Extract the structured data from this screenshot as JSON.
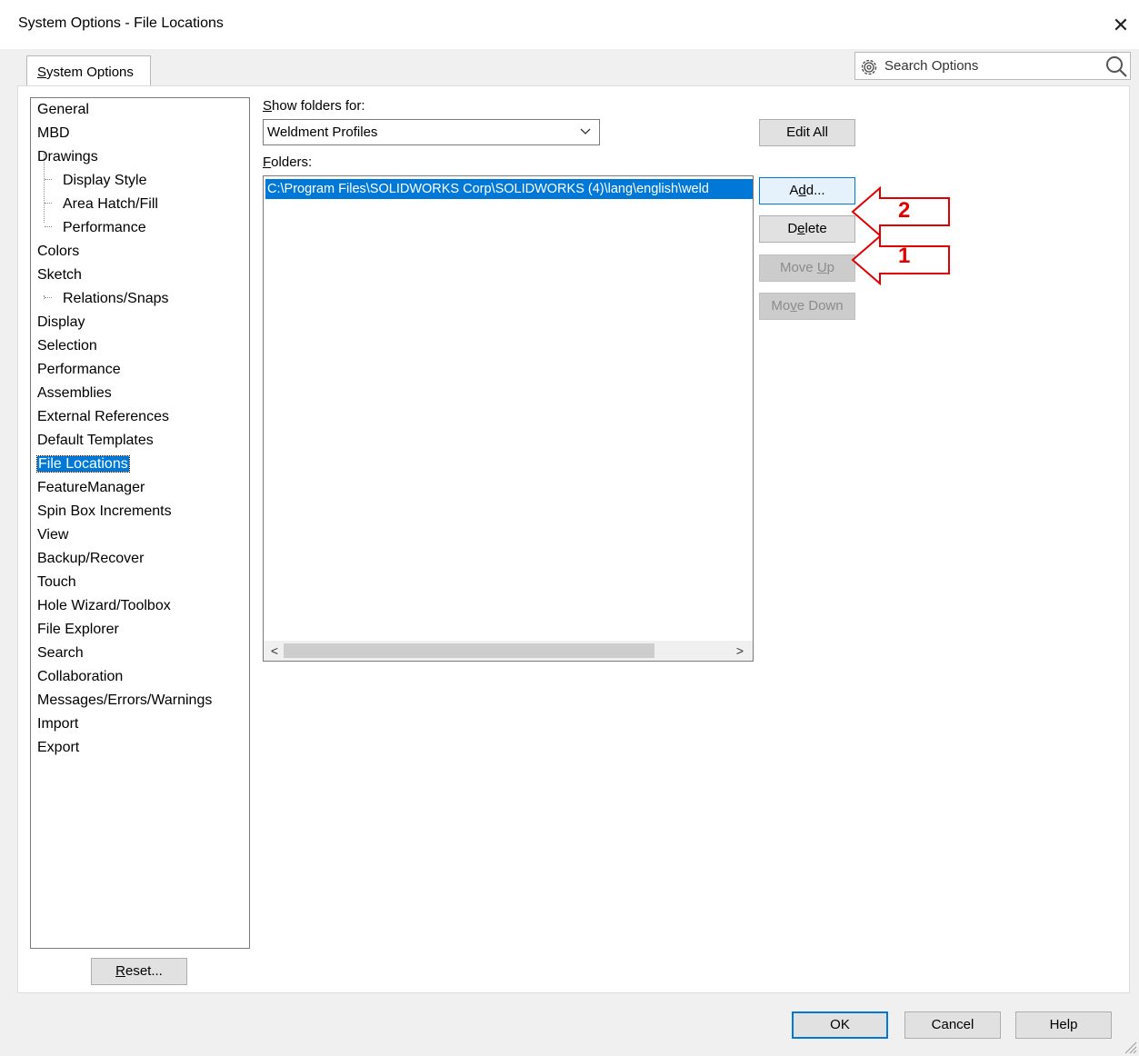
{
  "window": {
    "title": "System Options - File Locations",
    "close_glyph": "✕"
  },
  "tabs": [
    {
      "label_before": "",
      "accel": "S",
      "label_after": "ystem Options"
    }
  ],
  "search": {
    "placeholder": "Search Options"
  },
  "tree": {
    "items": [
      {
        "label": "General",
        "level": 0
      },
      {
        "label": "MBD",
        "level": 0
      },
      {
        "label": "Drawings",
        "level": 0
      },
      {
        "label": "Display Style",
        "level": 1
      },
      {
        "label": "Area Hatch/Fill",
        "level": 1
      },
      {
        "label": "Performance",
        "level": 1
      },
      {
        "label": "Colors",
        "level": 0
      },
      {
        "label": "Sketch",
        "level": 0
      },
      {
        "label": "Relations/Snaps",
        "level": 1
      },
      {
        "label": "Display",
        "level": 0
      },
      {
        "label": "Selection",
        "level": 0
      },
      {
        "label": "Performance",
        "level": 0
      },
      {
        "label": "Assemblies",
        "level": 0
      },
      {
        "label": "External References",
        "level": 0
      },
      {
        "label": "Default Templates",
        "level": 0
      },
      {
        "label": "File Locations",
        "level": 0,
        "selected": true
      },
      {
        "label": "FeatureManager",
        "level": 0
      },
      {
        "label": "Spin Box Increments",
        "level": 0
      },
      {
        "label": "View",
        "level": 0
      },
      {
        "label": "Backup/Recover",
        "level": 0
      },
      {
        "label": "Touch",
        "level": 0
      },
      {
        "label": "Hole Wizard/Toolbox",
        "level": 0
      },
      {
        "label": "File Explorer",
        "level": 0
      },
      {
        "label": "Search",
        "level": 0
      },
      {
        "label": "Collaboration",
        "level": 0
      },
      {
        "label": "Messages/Errors/Warnings",
        "level": 0
      },
      {
        "label": "Import",
        "level": 0
      },
      {
        "label": "Export",
        "level": 0
      }
    ]
  },
  "reset_button": {
    "accel": "R",
    "rest": "eset..."
  },
  "show_folders": {
    "label_accel": "S",
    "label_rest": "how folders for:",
    "selected": "Weldment Profiles"
  },
  "edit_all": {
    "label": "Edit All"
  },
  "folders": {
    "label_accel": "F",
    "label_rest": "olders:",
    "items": [
      "C:\\Program Files\\SOLIDWORKS Corp\\SOLIDWORKS (4)\\lang\\english\\weld"
    ]
  },
  "side_buttons": {
    "add": {
      "pre": "A",
      "accel": "d",
      "post": "d..."
    },
    "delete": {
      "pre": "D",
      "accel": "e",
      "post": "lete"
    },
    "move_up": {
      "pre": "Move ",
      "accel": "U",
      "post": "p"
    },
    "move_down": {
      "pre": "Mo",
      "accel": "v",
      "post": "e Down"
    }
  },
  "callouts": [
    {
      "number": "2"
    },
    {
      "number": "1"
    }
  ],
  "footer": {
    "ok": "OK",
    "cancel": "Cancel",
    "help": "Help"
  },
  "colors": {
    "accent": "#0078d7",
    "callout": "#e00000"
  }
}
